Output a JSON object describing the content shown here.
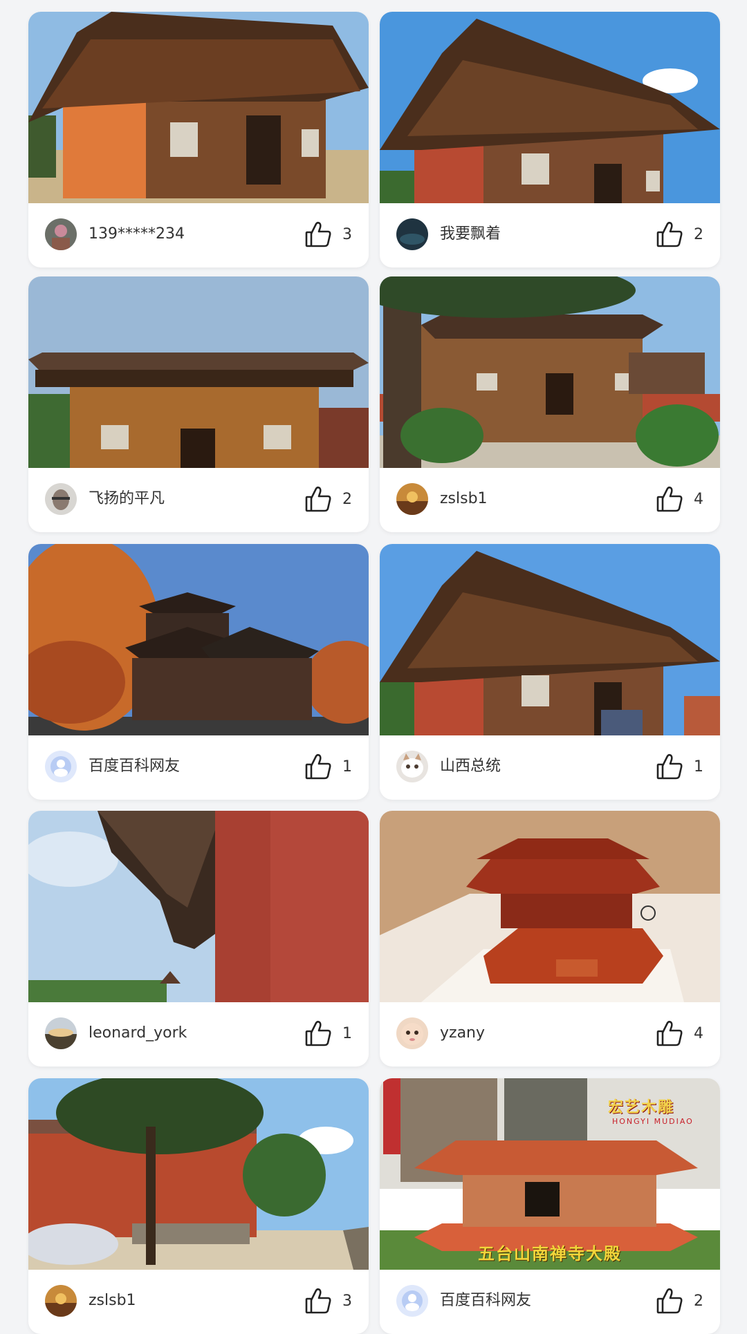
{
  "posts": [
    {
      "username": "139*****234",
      "likes": "3",
      "photo": "temple-hall-front"
    },
    {
      "username": "我要飘着",
      "likes": "2",
      "photo": "temple-hall-angle"
    },
    {
      "username": "飞扬的平凡",
      "likes": "2",
      "photo": "temple-hall-yellow"
    },
    {
      "username": "zslsb1",
      "likes": "4",
      "photo": "temple-courtyard"
    },
    {
      "username": "百度百科网友",
      "likes": "1",
      "photo": "pagoda-autumn"
    },
    {
      "username": "山西总统",
      "likes": "1",
      "photo": "temple-hall-visitors"
    },
    {
      "username": "leonard_york",
      "likes": "1",
      "photo": "temple-eaves"
    },
    {
      "username": "yzany",
      "likes": "4",
      "photo": "temple-model-museum"
    },
    {
      "username": "zslsb1",
      "likes": "3",
      "photo": "temple-wall-tree"
    },
    {
      "username": "百度百科网友",
      "likes": "2",
      "photo": "temple-model-carving"
    }
  ],
  "watermark": {
    "brand_cn": "宏艺木雕",
    "brand_en": "HONGYI MUDIAO",
    "caption": "五台山南禅寺大殿"
  },
  "icons": {
    "like": "thumbs-up-icon"
  },
  "colors": {
    "background": "#f3f4f6",
    "card": "#ffffff",
    "text": "#333333"
  }
}
